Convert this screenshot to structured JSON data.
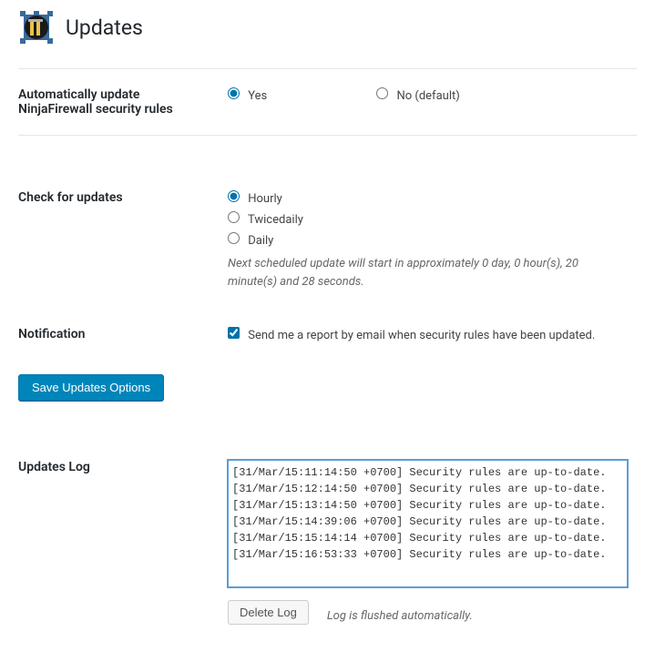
{
  "page": {
    "title": "Updates"
  },
  "auto_update": {
    "label": "Automatically update NinjaFirewall security rules",
    "yes": "Yes",
    "no": "No (default)",
    "selected": "yes"
  },
  "check_updates": {
    "label": "Check for updates",
    "options": {
      "hourly": "Hourly",
      "twicedaily": "Twicedaily",
      "daily": "Daily"
    },
    "selected": "hourly",
    "next_scheduled": "Next scheduled update will start in approximately 0 day, 0 hour(s), 20 minute(s) and 28 seconds."
  },
  "notification": {
    "label": "Notification",
    "checkbox_label": "Send me a report by email when security rules have been updated.",
    "checked": true
  },
  "buttons": {
    "save": "Save Updates Options",
    "delete_log": "Delete Log"
  },
  "updates_log": {
    "label": "Updates Log",
    "content": "[31/Mar/15:11:14:50 +0700] Security rules are up-to-date.\n[31/Mar/15:12:14:50 +0700] Security rules are up-to-date.\n[31/Mar/15:13:14:50 +0700] Security rules are up-to-date.\n[31/Mar/15:14:39:06 +0700] Security rules are up-to-date.\n[31/Mar/15:15:14:14 +0700] Security rules are up-to-date.\n[31/Mar/15:16:53:33 +0700] Security rules are up-to-date.",
    "flush_note": "Log is flushed automatically."
  }
}
